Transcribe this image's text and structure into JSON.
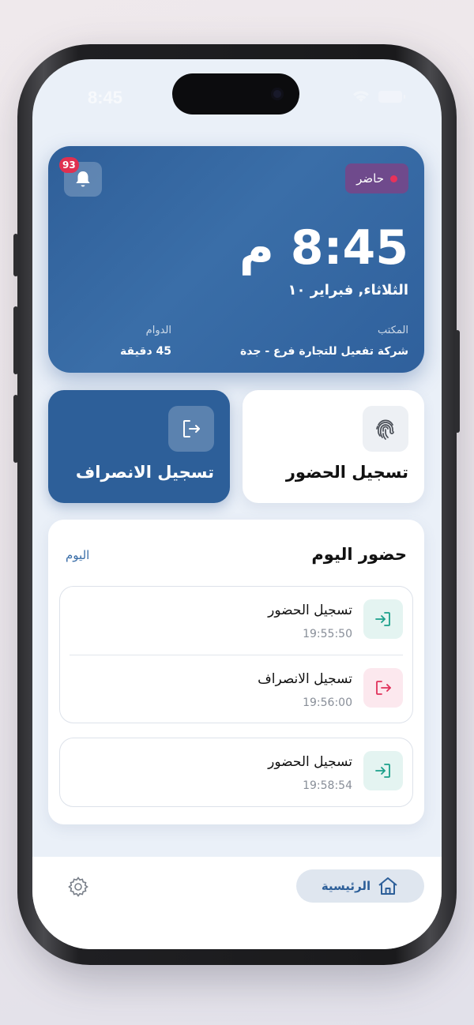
{
  "status_bar": {
    "time": "8:45"
  },
  "hero": {
    "status_badge": "حاضر",
    "notification_count": "93",
    "clock": "8:45 م",
    "date": "الثلاثاء, فبراير ١٠",
    "office_label": "المكتب",
    "office_value": "شركة تفعيل للتجارة فرع - جدة",
    "duration_label": "الدوام",
    "duration_value": "45 دقيقة"
  },
  "actions": {
    "checkin_label": "تسجيل الحضور",
    "checkout_label": "تسجيل الانصراف"
  },
  "today": {
    "title": "حضور اليوم",
    "filter": "اليوم",
    "groups": [
      [
        {
          "type": "in",
          "title": "تسجيل الحضور",
          "time": "19:55:50"
        },
        {
          "type": "out",
          "title": "تسجيل الانصراف",
          "time": "19:56:00"
        }
      ],
      [
        {
          "type": "in",
          "title": "تسجيل الحضور",
          "time": "19:58:54"
        }
      ]
    ]
  },
  "tabbar": {
    "home_label": "الرئيسية"
  },
  "icons": {
    "bell": "bell-icon",
    "fingerprint": "fingerprint-icon",
    "logout": "logout-icon",
    "login": "login-icon",
    "home": "home-icon",
    "settings": "settings-icon"
  },
  "colors": {
    "primary": "#2d5f99",
    "status_badge": "#6f4a8c",
    "status_dot": "#e8325a",
    "checkin_accent": "#1aa08a",
    "checkout_accent": "#e0305a"
  }
}
